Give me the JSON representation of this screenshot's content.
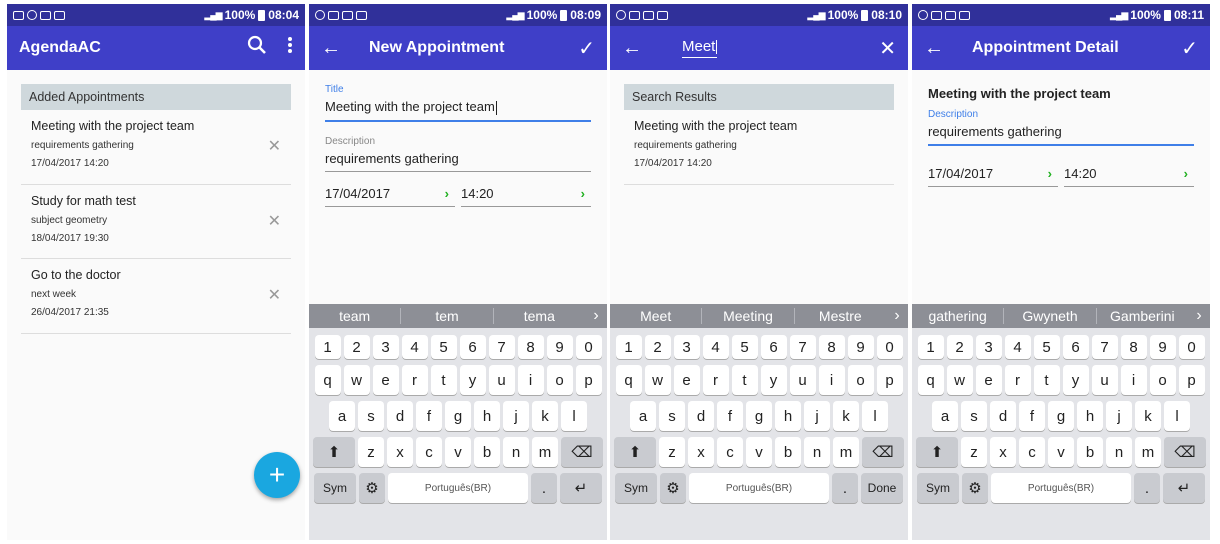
{
  "status_bars": [
    {
      "time": "08:04",
      "battery": "100%"
    },
    {
      "time": "08:09",
      "battery": "100%"
    },
    {
      "time": "08:10",
      "battery": "100%"
    },
    {
      "time": "08:11",
      "battery": "100%"
    }
  ],
  "screen1": {
    "title": "AgendaAC",
    "section": "Added Appointments",
    "items": [
      {
        "title": "Meeting with the project team",
        "desc": "requirements gathering",
        "datetime": "17/04/2017 14:20"
      },
      {
        "title": "Study for math test",
        "desc": "subject geometry",
        "datetime": "18/04/2017 19:30"
      },
      {
        "title": "Go to the doctor",
        "desc": "next week",
        "datetime": "26/04/2017 21:35"
      }
    ],
    "fab": "+"
  },
  "screen2": {
    "title": "New Appointment",
    "title_label": "Title",
    "title_value": "Meeting with the project team",
    "desc_label": "Description",
    "desc_value": "requirements gathering",
    "date": "17/04/2017",
    "time": "14:20"
  },
  "screen3": {
    "search_text": "Meet",
    "section": "Search Results",
    "item": {
      "title": "Meeting with the project team",
      "desc": "requirements gathering",
      "datetime": "17/04/2017 14:20"
    }
  },
  "screen4": {
    "title": "Appointment Detail",
    "detail_title": "Meeting with the project team",
    "desc_label": "Description",
    "desc_value": "requirements gathering",
    "date": "17/04/2017",
    "time": "14:20"
  },
  "keyboards": {
    "suggestions_s2": [
      "team",
      "tem",
      "tema"
    ],
    "suggestions_s3": [
      "Meet",
      "Meeting",
      "Mestre"
    ],
    "suggestions_s4": [
      "gathering",
      "Gwyneth",
      "Gamberini"
    ],
    "numbers": [
      "1",
      "2",
      "3",
      "4",
      "5",
      "6",
      "7",
      "8",
      "9",
      "0"
    ],
    "row_q": [
      "q",
      "w",
      "e",
      "r",
      "t",
      "y",
      "u",
      "i",
      "o",
      "p"
    ],
    "row_a": [
      "a",
      "s",
      "d",
      "f",
      "g",
      "h",
      "j",
      "k",
      "l"
    ],
    "row_z": [
      "z",
      "x",
      "c",
      "v",
      "b",
      "n",
      "m"
    ],
    "sym": "Sym",
    "space": "Português(BR)",
    "dot": ".",
    "done": "Done"
  }
}
